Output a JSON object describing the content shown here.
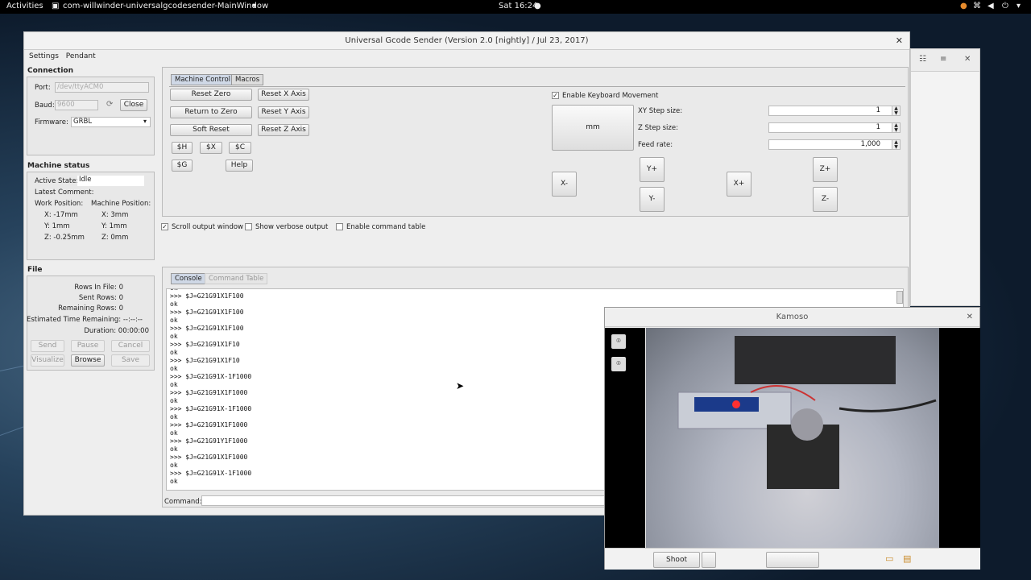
{
  "topbar": {
    "activities": "Activities",
    "app_title": "com-willwinder-universalgcodesender-MainWindow",
    "clock": "Sat 16:24"
  },
  "ugs": {
    "title": "Universal Gcode Sender (Version 2.0 [nightly]  / Jul 23, 2017)",
    "menu": [
      "Settings",
      "Pendant"
    ],
    "connection": {
      "heading": "Connection",
      "port_label": "Port:",
      "port_value": "/dev/ttyACM0",
      "baud_label": "Baud:",
      "baud_value": "9600",
      "close_label": "Close",
      "firmware_label": "Firmware:",
      "firmware_value": "GRBL"
    },
    "status": {
      "heading": "Machine status",
      "active_state_label": "Active State:",
      "active_state_value": "Idle",
      "latest_comment_label": "Latest Comment:",
      "work_pos_label": "Work Position:",
      "machine_pos_label": "Machine Position:",
      "work": [
        "X:  -17mm",
        "Y:  1mm",
        "Z:  -0.25mm"
      ],
      "machine": [
        "X:  3mm",
        "Y:  1mm",
        "Z:  0mm"
      ]
    },
    "file": {
      "heading": "File",
      "rows_in_file": "Rows In File:  0",
      "sent_rows": "Sent Rows:  0",
      "remaining_rows": "Remaining Rows:  0",
      "est_time": "Estimated Time Remaining:  --:--:--",
      "duration": "Duration:  00:00:00",
      "send": "Send",
      "pause": "Pause",
      "cancel": "Cancel",
      "visualize": "Visualize",
      "browse": "Browse",
      "save": "Save"
    },
    "tabs": {
      "machine_control": "Machine Control",
      "macros": "Macros",
      "console": "Console",
      "command_table": "Command Table"
    },
    "buttons": {
      "reset_zero": "Reset Zero",
      "return_zero": "Return to Zero",
      "soft_reset": "Soft Reset",
      "reset_x": "Reset X Axis",
      "reset_y": "Reset Y Axis",
      "reset_z": "Reset Z Axis",
      "h": "$H",
      "x": "$X",
      "c": "$C",
      "g": "$G",
      "help": "Help"
    },
    "jog": {
      "enable_kb": "Enable Keyboard Movement",
      "mm": "mm",
      "xy_step_label": "XY Step size:",
      "xy_step": "1",
      "z_step_label": "Z Step size:",
      "z_step": "1",
      "feed_label": "Feed rate:",
      "feed": "1,000",
      "x_minus": "X-",
      "x_plus": "X+",
      "y_plus": "Y+",
      "y_minus": "Y-",
      "z_plus": "Z+",
      "z_minus": "Z-"
    },
    "options": {
      "scroll": "Scroll output window",
      "verbose": "Show verbose output",
      "cmd_table": "Enable command table"
    },
    "console_lines": [
      "ok",
      ">>> $J=G21G91X1F100",
      "ok",
      ">>> $J=G21G91X1F100",
      "ok",
      ">>> $J=G21G91X1F100",
      "ok",
      ">>> $J=G21G91X1F10",
      "ok",
      ">>> $J=G21G91X1F10",
      "ok",
      ">>> $J=G21G91X-1F1000",
      "ok",
      ">>> $J=G21G91X1F1000",
      "ok",
      ">>> $J=G21G91X-1F1000",
      "ok",
      ">>> $J=G21G91X1F1000",
      "ok",
      ">>> $J=G21G91Y1F1000",
      "ok",
      ">>> $J=G21G91X1F1000",
      "ok",
      ">>> $J=G21G91X-1F1000",
      "ok"
    ],
    "command_label": "Command:"
  },
  "kamoso": {
    "title": "Kamoso",
    "shoot": "Shoot"
  }
}
